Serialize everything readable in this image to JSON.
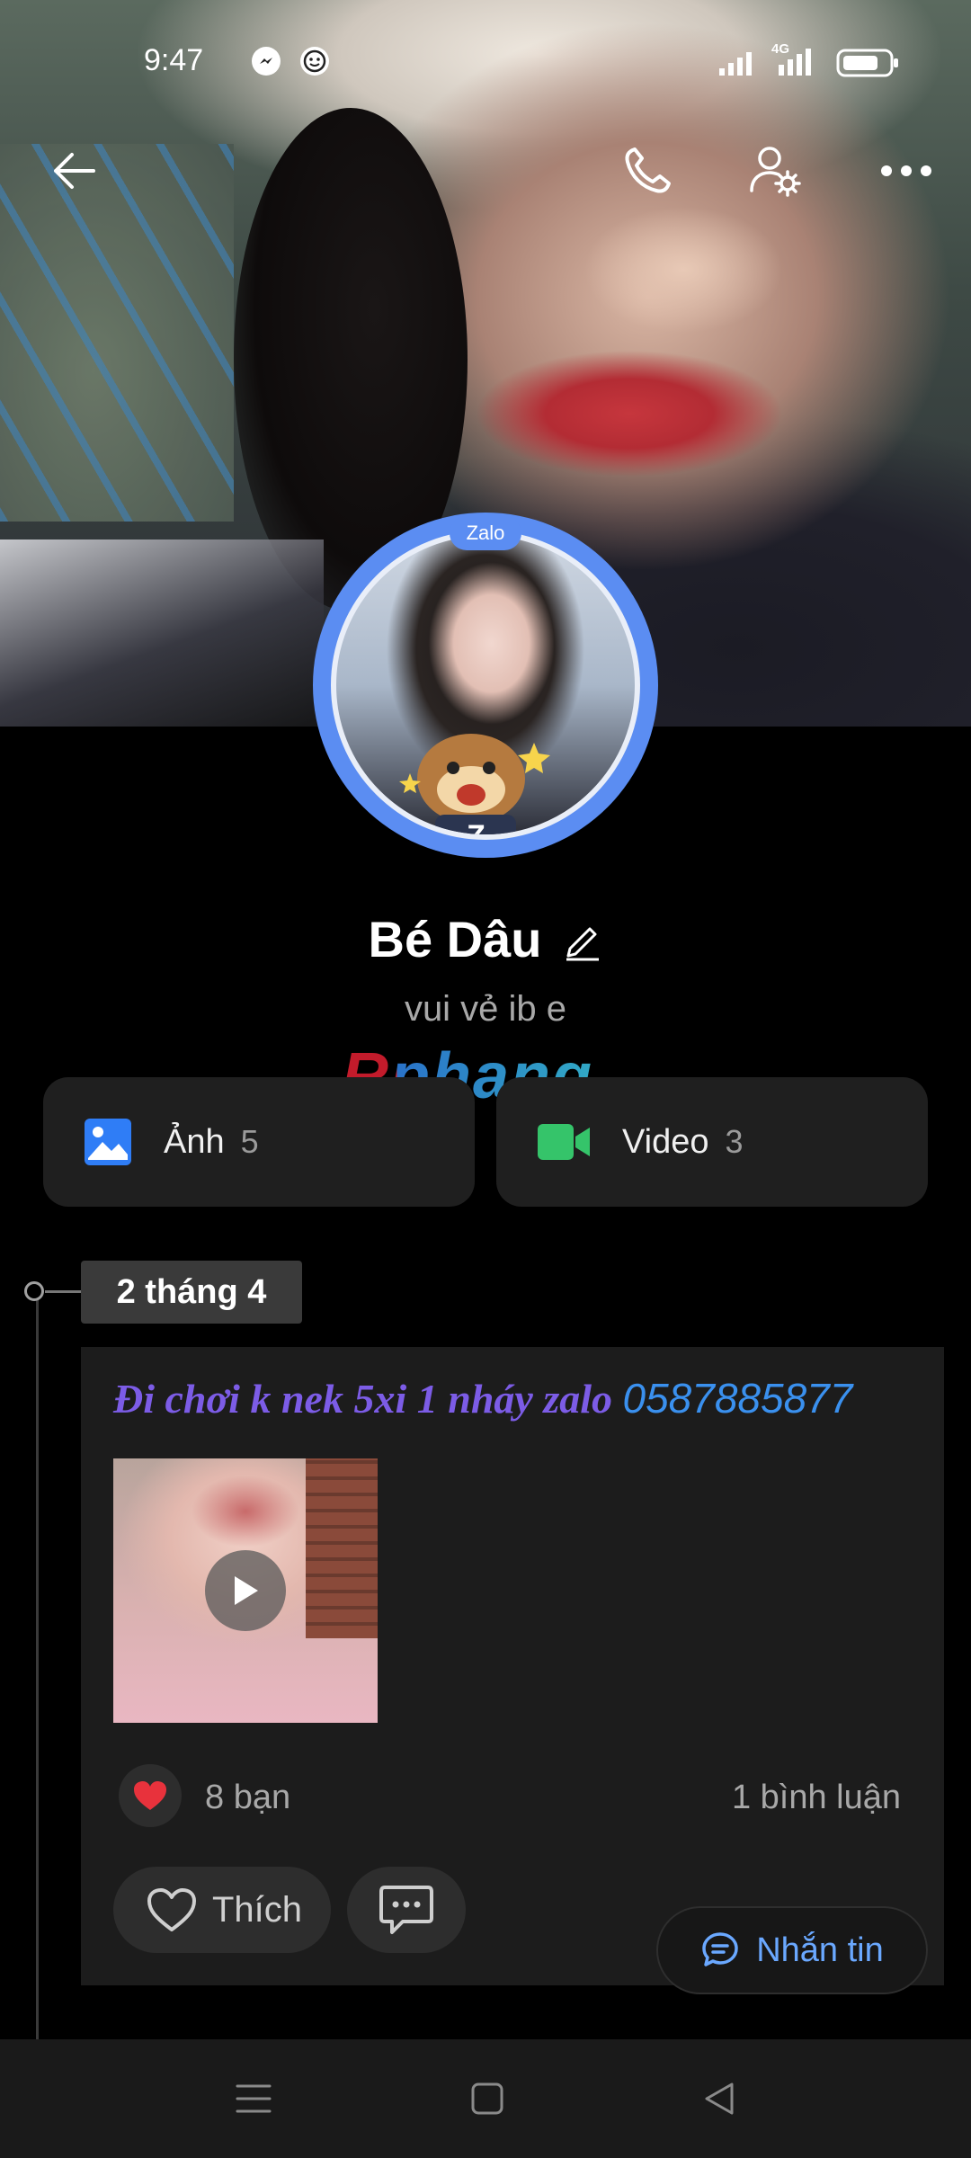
{
  "status_bar": {
    "time": "9:47",
    "network": "4G"
  },
  "cover": {
    "avatar_badge": "Zalo"
  },
  "profile": {
    "name": "Bé Dâu",
    "bio": "vui vẻ ib e"
  },
  "watermark": "Rphang",
  "media": {
    "photos": {
      "label": "Ảnh",
      "count": "5"
    },
    "videos": {
      "label": "Video",
      "count": "3"
    }
  },
  "timeline": {
    "date": "2 tháng 4",
    "post": {
      "text_part1": "Đi chơi k nek 5xi 1 nháy zalo",
      "text_part2": "0587885877",
      "reactions": "8 bạn",
      "comments": "1 bình luận",
      "like_label": "Thích"
    }
  },
  "actions": {
    "message_label": "Nhắn tin"
  },
  "colors": {
    "accent_blue": "#5b8df2",
    "message_blue": "#6aa8ff",
    "photo_icon": "#2f7df6",
    "video_icon": "#35c46a",
    "heart": "#e8323c"
  }
}
